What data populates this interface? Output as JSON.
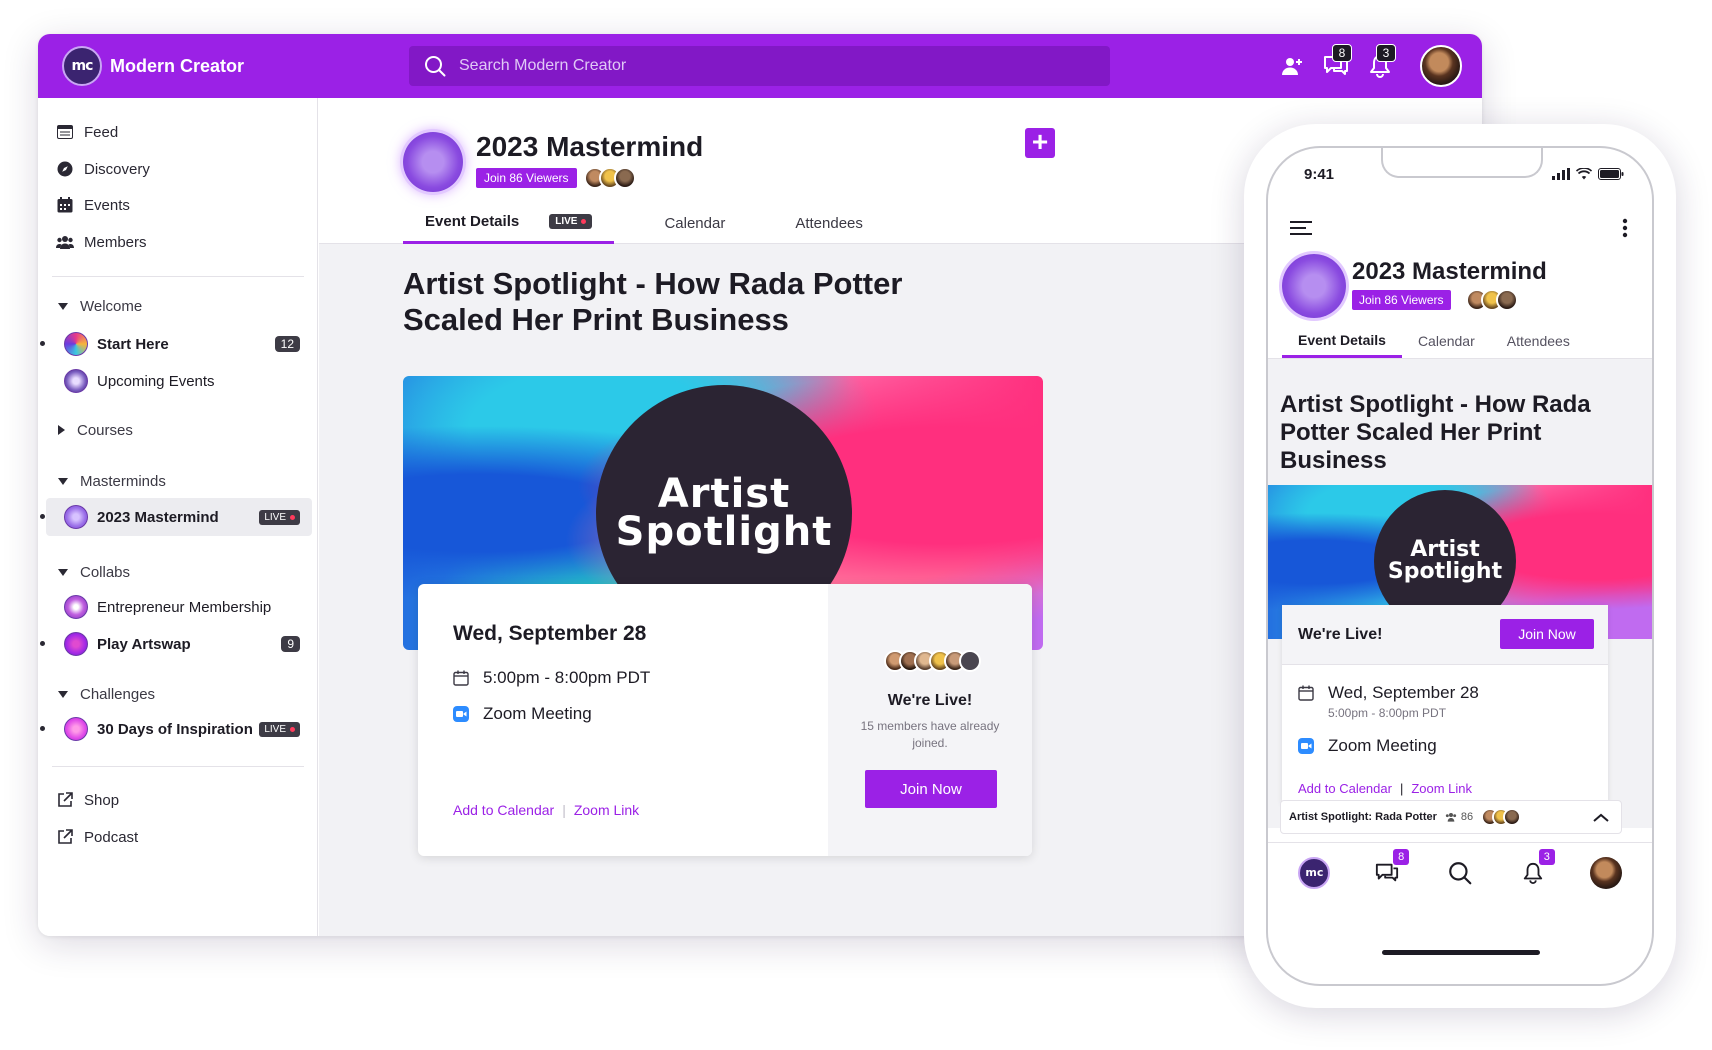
{
  "app": {
    "name": "Modern Creator",
    "logo_text": "mc"
  },
  "search": {
    "placeholder": "Search Modern Creator"
  },
  "header": {
    "messages_badge": "8",
    "notifications_badge": "3"
  },
  "sidebar": {
    "nav": [
      {
        "label": "Feed",
        "icon": "feed-icon"
      },
      {
        "label": "Discovery",
        "icon": "compass-icon"
      },
      {
        "label": "Events",
        "icon": "calendar-icon"
      },
      {
        "label": "Members",
        "icon": "members-icon"
      }
    ],
    "groups": {
      "welcome": "Welcome",
      "courses": "Courses",
      "masterminds": "Masterminds",
      "collabs": "Collabs",
      "challenges": "Challenges"
    },
    "spaces": {
      "start_here": {
        "label": "Start Here",
        "count": "12"
      },
      "upcoming_events": {
        "label": "Upcoming Events"
      },
      "mastermind_2023": {
        "label": "2023 Mastermind",
        "live": "LIVE"
      },
      "entrepreneur": {
        "label": "Entrepreneur Membership"
      },
      "play_artswap": {
        "label": "Play Artswap",
        "count": "9"
      },
      "thirty_days": {
        "label": "30 Days of Inspiration",
        "live": "LIVE"
      }
    },
    "links": [
      {
        "label": "Shop",
        "icon": "external-link-icon"
      },
      {
        "label": "Podcast",
        "icon": "external-link-icon"
      }
    ]
  },
  "event": {
    "title": "2023 Mastermind",
    "viewers_label": "Join 86 Viewers",
    "tabs": {
      "details": "Event Details",
      "live": "LIVE",
      "calendar": "Calendar",
      "attendees": "Attendees"
    },
    "article_title": "Artist Spotlight - How Rada Potter Scaled Her Print Business",
    "hero_line1": "Artist",
    "hero_line2": "Spotlight",
    "date": "Wed, September 28",
    "time": "5:00pm - 8:00pm PDT",
    "location": "Zoom Meeting",
    "add_calendar": "Add to Calendar",
    "zoom_link": "Zoom Link",
    "live_title": "We're Live!",
    "live_sub": "15 members have already joined.",
    "join_label": "Join Now"
  },
  "phone": {
    "time": "9:41",
    "tabs": {
      "details": "Event Details",
      "calendar": "Calendar",
      "attendees": "Attendees"
    },
    "article_title": "Artist Spotlight - How Rada Potter Scaled Her Print Business",
    "mini_player": {
      "title": "Artist Spotlight: Rada Potter",
      "count": "86"
    },
    "nav": {
      "messages_badge": "8",
      "notifications_badge": "3"
    }
  },
  "colors": {
    "brand": "#9b21e6",
    "dark": "#1d1b24",
    "live_red": "#ff3b5c"
  }
}
